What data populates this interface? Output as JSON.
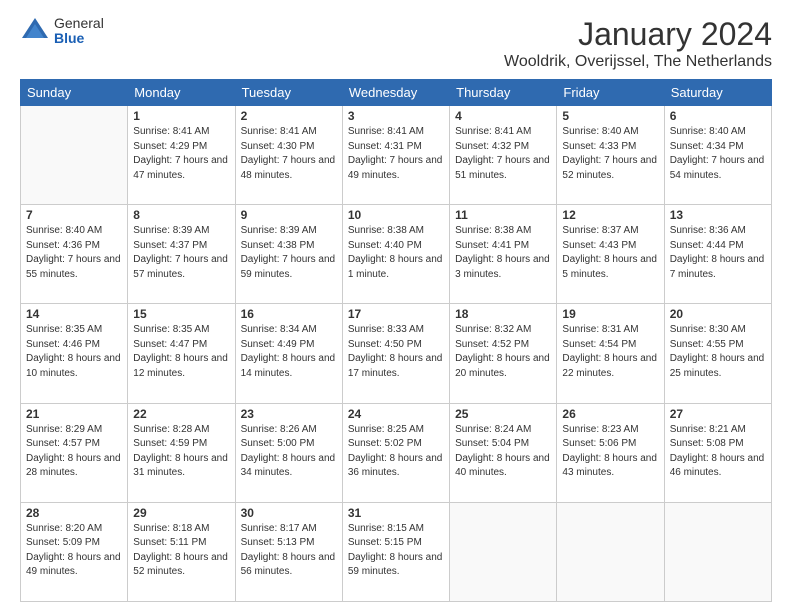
{
  "logo": {
    "general": "General",
    "blue": "Blue"
  },
  "title": "January 2024",
  "subtitle": "Wooldrik, Overijssel, The Netherlands",
  "weekdays": [
    "Sunday",
    "Monday",
    "Tuesday",
    "Wednesday",
    "Thursday",
    "Friday",
    "Saturday"
  ],
  "weeks": [
    [
      {
        "day": "",
        "sunrise": "",
        "sunset": "",
        "daylight": ""
      },
      {
        "day": "1",
        "sunrise": "Sunrise: 8:41 AM",
        "sunset": "Sunset: 4:29 PM",
        "daylight": "Daylight: 7 hours and 47 minutes."
      },
      {
        "day": "2",
        "sunrise": "Sunrise: 8:41 AM",
        "sunset": "Sunset: 4:30 PM",
        "daylight": "Daylight: 7 hours and 48 minutes."
      },
      {
        "day": "3",
        "sunrise": "Sunrise: 8:41 AM",
        "sunset": "Sunset: 4:31 PM",
        "daylight": "Daylight: 7 hours and 49 minutes."
      },
      {
        "day": "4",
        "sunrise": "Sunrise: 8:41 AM",
        "sunset": "Sunset: 4:32 PM",
        "daylight": "Daylight: 7 hours and 51 minutes."
      },
      {
        "day": "5",
        "sunrise": "Sunrise: 8:40 AM",
        "sunset": "Sunset: 4:33 PM",
        "daylight": "Daylight: 7 hours and 52 minutes."
      },
      {
        "day": "6",
        "sunrise": "Sunrise: 8:40 AM",
        "sunset": "Sunset: 4:34 PM",
        "daylight": "Daylight: 7 hours and 54 minutes."
      }
    ],
    [
      {
        "day": "7",
        "sunrise": "Sunrise: 8:40 AM",
        "sunset": "Sunset: 4:36 PM",
        "daylight": "Daylight: 7 hours and 55 minutes."
      },
      {
        "day": "8",
        "sunrise": "Sunrise: 8:39 AM",
        "sunset": "Sunset: 4:37 PM",
        "daylight": "Daylight: 7 hours and 57 minutes."
      },
      {
        "day": "9",
        "sunrise": "Sunrise: 8:39 AM",
        "sunset": "Sunset: 4:38 PM",
        "daylight": "Daylight: 7 hours and 59 minutes."
      },
      {
        "day": "10",
        "sunrise": "Sunrise: 8:38 AM",
        "sunset": "Sunset: 4:40 PM",
        "daylight": "Daylight: 8 hours and 1 minute."
      },
      {
        "day": "11",
        "sunrise": "Sunrise: 8:38 AM",
        "sunset": "Sunset: 4:41 PM",
        "daylight": "Daylight: 8 hours and 3 minutes."
      },
      {
        "day": "12",
        "sunrise": "Sunrise: 8:37 AM",
        "sunset": "Sunset: 4:43 PM",
        "daylight": "Daylight: 8 hours and 5 minutes."
      },
      {
        "day": "13",
        "sunrise": "Sunrise: 8:36 AM",
        "sunset": "Sunset: 4:44 PM",
        "daylight": "Daylight: 8 hours and 7 minutes."
      }
    ],
    [
      {
        "day": "14",
        "sunrise": "Sunrise: 8:35 AM",
        "sunset": "Sunset: 4:46 PM",
        "daylight": "Daylight: 8 hours and 10 minutes."
      },
      {
        "day": "15",
        "sunrise": "Sunrise: 8:35 AM",
        "sunset": "Sunset: 4:47 PM",
        "daylight": "Daylight: 8 hours and 12 minutes."
      },
      {
        "day": "16",
        "sunrise": "Sunrise: 8:34 AM",
        "sunset": "Sunset: 4:49 PM",
        "daylight": "Daylight: 8 hours and 14 minutes."
      },
      {
        "day": "17",
        "sunrise": "Sunrise: 8:33 AM",
        "sunset": "Sunset: 4:50 PM",
        "daylight": "Daylight: 8 hours and 17 minutes."
      },
      {
        "day": "18",
        "sunrise": "Sunrise: 8:32 AM",
        "sunset": "Sunset: 4:52 PM",
        "daylight": "Daylight: 8 hours and 20 minutes."
      },
      {
        "day": "19",
        "sunrise": "Sunrise: 8:31 AM",
        "sunset": "Sunset: 4:54 PM",
        "daylight": "Daylight: 8 hours and 22 minutes."
      },
      {
        "day": "20",
        "sunrise": "Sunrise: 8:30 AM",
        "sunset": "Sunset: 4:55 PM",
        "daylight": "Daylight: 8 hours and 25 minutes."
      }
    ],
    [
      {
        "day": "21",
        "sunrise": "Sunrise: 8:29 AM",
        "sunset": "Sunset: 4:57 PM",
        "daylight": "Daylight: 8 hours and 28 minutes."
      },
      {
        "day": "22",
        "sunrise": "Sunrise: 8:28 AM",
        "sunset": "Sunset: 4:59 PM",
        "daylight": "Daylight: 8 hours and 31 minutes."
      },
      {
        "day": "23",
        "sunrise": "Sunrise: 8:26 AM",
        "sunset": "Sunset: 5:00 PM",
        "daylight": "Daylight: 8 hours and 34 minutes."
      },
      {
        "day": "24",
        "sunrise": "Sunrise: 8:25 AM",
        "sunset": "Sunset: 5:02 PM",
        "daylight": "Daylight: 8 hours and 36 minutes."
      },
      {
        "day": "25",
        "sunrise": "Sunrise: 8:24 AM",
        "sunset": "Sunset: 5:04 PM",
        "daylight": "Daylight: 8 hours and 40 minutes."
      },
      {
        "day": "26",
        "sunrise": "Sunrise: 8:23 AM",
        "sunset": "Sunset: 5:06 PM",
        "daylight": "Daylight: 8 hours and 43 minutes."
      },
      {
        "day": "27",
        "sunrise": "Sunrise: 8:21 AM",
        "sunset": "Sunset: 5:08 PM",
        "daylight": "Daylight: 8 hours and 46 minutes."
      }
    ],
    [
      {
        "day": "28",
        "sunrise": "Sunrise: 8:20 AM",
        "sunset": "Sunset: 5:09 PM",
        "daylight": "Daylight: 8 hours and 49 minutes."
      },
      {
        "day": "29",
        "sunrise": "Sunrise: 8:18 AM",
        "sunset": "Sunset: 5:11 PM",
        "daylight": "Daylight: 8 hours and 52 minutes."
      },
      {
        "day": "30",
        "sunrise": "Sunrise: 8:17 AM",
        "sunset": "Sunset: 5:13 PM",
        "daylight": "Daylight: 8 hours and 56 minutes."
      },
      {
        "day": "31",
        "sunrise": "Sunrise: 8:15 AM",
        "sunset": "Sunset: 5:15 PM",
        "daylight": "Daylight: 8 hours and 59 minutes."
      },
      {
        "day": "",
        "sunrise": "",
        "sunset": "",
        "daylight": ""
      },
      {
        "day": "",
        "sunrise": "",
        "sunset": "",
        "daylight": ""
      },
      {
        "day": "",
        "sunrise": "",
        "sunset": "",
        "daylight": ""
      }
    ]
  ]
}
